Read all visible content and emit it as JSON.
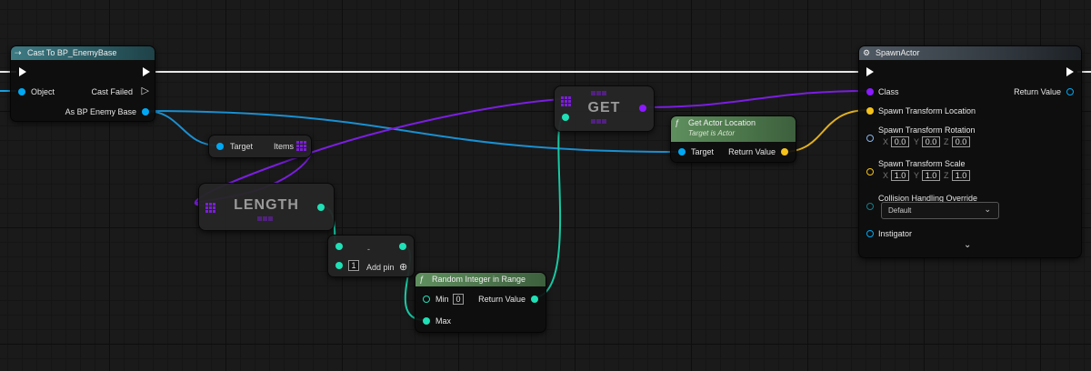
{
  "colors": {
    "exec": "#ffffff",
    "object": "#00a8f3",
    "integer": "#1fe0b6",
    "vector": "#f5c21a",
    "class": "#8a1aff",
    "function_header": "#5f8f5e",
    "pure_header": "#3e7a83"
  },
  "cast_node": {
    "title": "Cast To BP_EnemyBase",
    "pin_object": "Object",
    "pin_cast_failed": "Cast Failed",
    "pin_as_enemy": "As BP Enemy Base"
  },
  "get_array_node": {
    "pin_target": "Target",
    "pin_items": "Items"
  },
  "length_node": {
    "title": "LENGTH"
  },
  "get_node": {
    "title": "GET"
  },
  "subtract_node": {
    "title": "-",
    "value": "1",
    "add_pin": "Add pin"
  },
  "random_node": {
    "title": "Random Integer in Range",
    "pin_min": "Min",
    "min_value": "0",
    "pin_max": "Max",
    "pin_return": "Return Value"
  },
  "location_node": {
    "title": "Get Actor Location",
    "subtitle": "Target is Actor",
    "pin_target": "Target",
    "pin_return": "Return Value"
  },
  "spawn_node": {
    "title": "SpawnActor",
    "pin_class": "Class",
    "pin_return": "Return Value",
    "pin_location": "Spawn Transform Location",
    "pin_rotation": "Spawn Transform Rotation",
    "rotation": {
      "x": "0.0",
      "y": "0.0",
      "z": "0.0"
    },
    "pin_scale": "Spawn Transform Scale",
    "scale": {
      "x": "1.0",
      "y": "1.0",
      "z": "1.0"
    },
    "axis_x": "X",
    "axis_y": "Y",
    "axis_z": "Z",
    "pin_collision": "Collision Handling Override",
    "collision_value": "Default",
    "pin_instigator": "Instigator"
  }
}
